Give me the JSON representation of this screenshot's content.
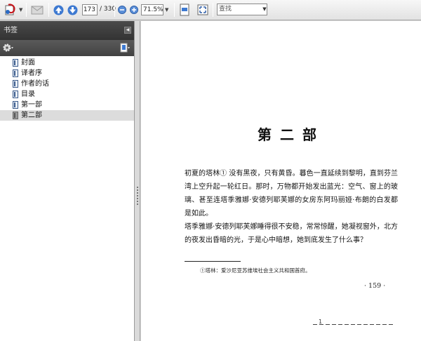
{
  "toolbar": {
    "page_current": "173",
    "page_total": "/ 330",
    "zoom": "71.5%",
    "search_placeholder": "查找"
  },
  "sidebar": {
    "title": "书签",
    "bookmarks": [
      {
        "label": "封面"
      },
      {
        "label": "译者序"
      },
      {
        "label": "作者的话"
      },
      {
        "label": "目录"
      },
      {
        "label": "第一部"
      },
      {
        "label": "第二部",
        "selected": true
      }
    ]
  },
  "document": {
    "chapter_title": "第二部",
    "paragraph_1": "初夏的塔林① 没有黑夜，只有黄昏。暮色一直延续到黎明，直到芬兰湾上空升起一轮红日。那时，万物都开始发出蓝光：空气、窗上的玻璃、甚至连塔季雅娜·安德列耶芙娜的女房东阿玛丽娅·布朗的白发都是如此。",
    "paragraph_2": "塔季雅娜·安德列耶芙娜睡得很不安稳，常常惊醒，她凝视窗外，北方的夜发出昏暗的光，于是心中暗想，她到底发生了什么事？",
    "footnote": "①塔林：爱沙尼亚苏维埃社会主义共和国首府。",
    "page_number": "· 159 ·",
    "bottom_mark": "1"
  }
}
